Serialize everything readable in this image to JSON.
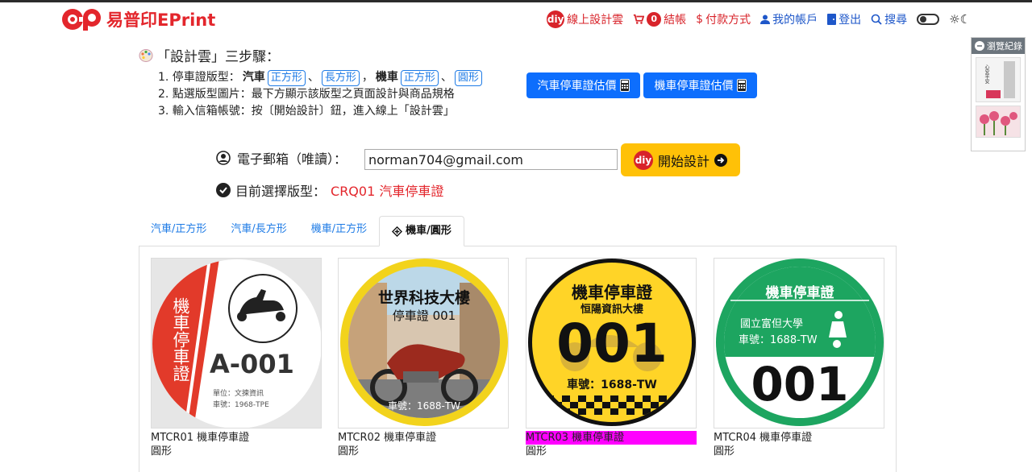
{
  "header": {
    "logo_text": "易普印EPrint",
    "nav": {
      "diy_badge": "diy",
      "online_design": "線上設計雲",
      "cart_count": "0",
      "checkout": "結帳",
      "payment": "付款方式",
      "account": "我的帳戶",
      "logout": "登出",
      "search": "搜尋"
    }
  },
  "steps": {
    "title": "「設計雲」三步驟：",
    "step1_prefix": "1. 停車證版型：",
    "step1_car": "汽車",
    "step1_chip1": "正方形",
    "step1_sep1": "、",
    "step1_chip2": "長方形",
    "step1_sep2": "，",
    "step1_moto": "機車",
    "step1_chip3": "正方形",
    "step1_sep3": "、",
    "step1_chip4": "圓形",
    "step2": "2. 點選版型圖片：最下方顯示該版型之頁面設計與商品規格",
    "step3": "3. 輸入信箱帳號：按〔開始設計〕鈕，進入線上「設計雲」"
  },
  "buttons": {
    "car_estimate": "汽車停車證估價",
    "moto_estimate": "機車停車證估價"
  },
  "email": {
    "label": "電子郵箱（唯讀）：",
    "value": "norman704@gmail.com",
    "start_diy": "diy",
    "start_label": "開始設計"
  },
  "selected": {
    "label": "目前選擇版型：",
    "value": "CRQ01 汽車停車證"
  },
  "tabs": [
    "汽車/正方形",
    "汽車/長方形",
    "機車/正方形",
    "機車/圓形"
  ],
  "cards": [
    {
      "name": "MTCR01 機車停車證",
      "shape": "圓形",
      "art": {
        "side": "機車停車證",
        "code": "A-001",
        "line1": "單位：文揀資訊",
        "line2": "車號：1968-TPE"
      }
    },
    {
      "name": "MTCR02 機車停車證",
      "shape": "圓形",
      "art": {
        "title": "世界科技大樓",
        "sub": "停車證 001",
        "plate": "車號：1688-TW"
      }
    },
    {
      "name": "MTCR03 機車停車證",
      "shape": "圓形",
      "art": {
        "title": "機車停車證",
        "sub": "恒陽資訊大樓",
        "num": "001",
        "plate": "車號：1688-TW"
      }
    },
    {
      "name": "MTCR04 機車停車證",
      "shape": "圓形",
      "art": {
        "title": "機車停車證",
        "org": "國立富但大學",
        "plate": "車號：1688-TW",
        "num": "001"
      }
    }
  ],
  "history": {
    "title": "瀏覽紀錄",
    "item1_text": "心安平安"
  },
  "colors": {
    "brand_red": "#e3262c",
    "link_blue": "#1e7be6",
    "primary": "#0d6efd",
    "warning": "#ffc107",
    "highlight": "#ff00ff"
  }
}
